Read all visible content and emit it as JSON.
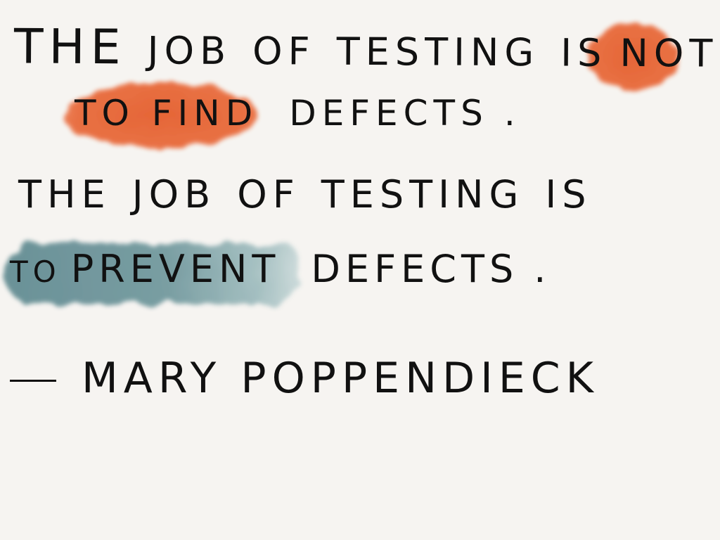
{
  "quote": {
    "line1": {
      "w1": "The",
      "w2": "Job",
      "w3": "of",
      "w4": "Testing",
      "w5": "is",
      "w6": "not"
    },
    "line2": {
      "w1": "to find",
      "w2": "Defects",
      "end": "."
    },
    "line3": {
      "w1": "The",
      "w2": "Job",
      "w3": "of",
      "w4": "Testing",
      "w5": "is"
    },
    "line4": {
      "w1": "to",
      "w2": "Prevent",
      "w3": "Defects",
      "end": "."
    },
    "attribution": {
      "name": "Mary Poppendieck"
    }
  },
  "colors": {
    "background": "#f6f4f1",
    "ink": "#111111",
    "orange_highlight": "#e8693a",
    "teal_highlight": "#6f959a"
  }
}
